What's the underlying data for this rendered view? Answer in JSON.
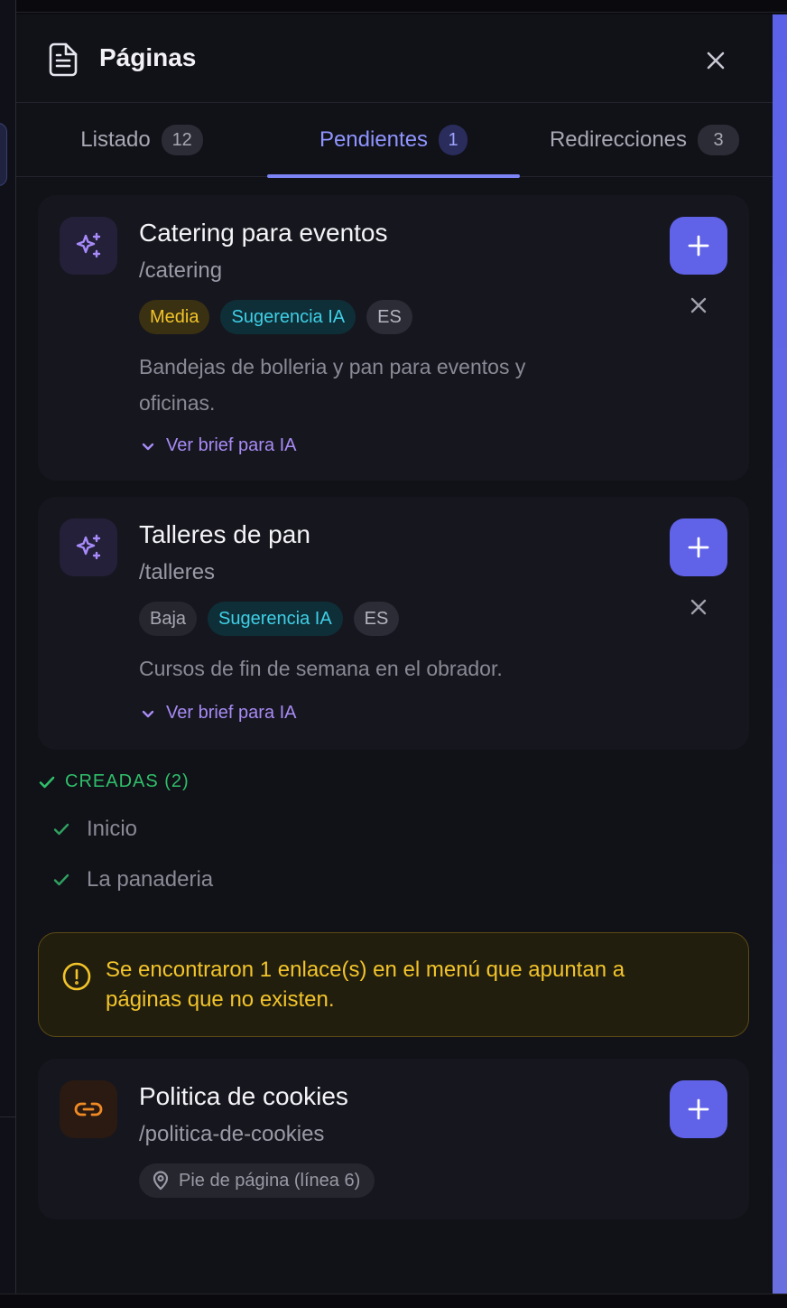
{
  "panel": {
    "title": "Páginas",
    "icons": {
      "title_icon": "document-icon",
      "close_icon": "close-icon"
    }
  },
  "tabs": [
    {
      "label": "Listado",
      "count": "12",
      "active": false
    },
    {
      "label": "Pendientes",
      "count": "1",
      "active": true
    },
    {
      "label": "Redirecciones",
      "count": "3",
      "active": false
    }
  ],
  "pending": [
    {
      "title": "Catering para eventos",
      "path": "/catering",
      "priority": "Media",
      "source": "Sugerencia IA",
      "lang": "ES",
      "description": "Bandejas de bolleria y pan para eventos y oficinas.",
      "brief_label": "Ver brief para IA",
      "icon": "sparkles-icon"
    },
    {
      "title": "Talleres de pan",
      "path": "/talleres",
      "priority": "Baja",
      "source": "Sugerencia IA",
      "lang": "ES",
      "description": "Cursos de fin de semana en el obrador.",
      "brief_label": "Ver brief para IA",
      "icon": "sparkles-icon"
    }
  ],
  "created": {
    "header": "CREADAS (2)",
    "items": [
      "Inicio",
      "La panaderia"
    ]
  },
  "warning": {
    "text": "Se encontraron 1 enlace(s) en el menú que apuntan a páginas que no existen."
  },
  "broken_link": {
    "title": "Politica de cookies",
    "path": "/politica-de-cookies",
    "location": "Pie de página (línea 6)",
    "icon": "link-icon"
  },
  "colors": {
    "accent": "#6062e8",
    "active_tab": "#8f95ff",
    "success": "#2fbf6a",
    "warning": "#f2c42a",
    "ai_badge": "#3fcfe6",
    "media_badge": "#f2c42a"
  }
}
